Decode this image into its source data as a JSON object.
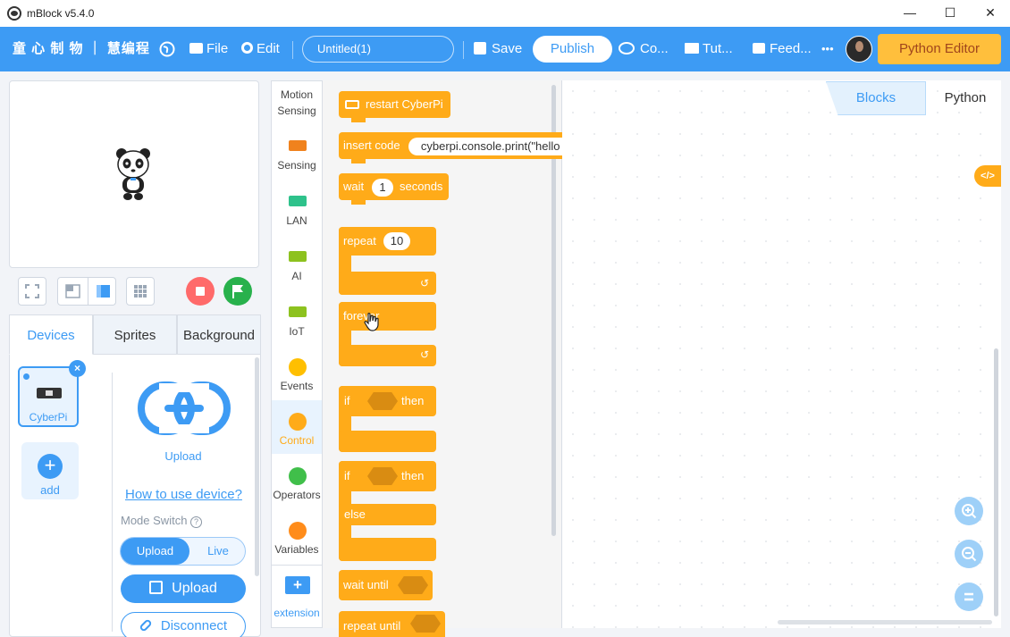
{
  "window": {
    "title": "mBlock v5.4.0",
    "minimize": "—",
    "maximize": "☐",
    "close": "✕"
  },
  "menu": {
    "brand_text": "童 心 制 物 ｜ 慧编程",
    "file": "File",
    "edit": "Edit",
    "project_name": "Untitled(1)",
    "save": "Save",
    "publish": "Publish",
    "community": "Co...",
    "tutorials": "Tut...",
    "feedback": "Feed...",
    "more": "•••",
    "python_editor": "Python Editor"
  },
  "stage": {
    "panda_icon": "panda-sprite"
  },
  "left_tabs": [
    "Devices",
    "Sprites",
    "Background"
  ],
  "device": {
    "name": "CyberPi",
    "add_label": "add",
    "upload_caption": "Upload",
    "help_link": "How to use device?",
    "mode_switch": "Mode Switch",
    "mode_upload": "Upload",
    "mode_live": "Live",
    "upload_button": "Upload",
    "disconnect_button": "Disconnect"
  },
  "categories": [
    {
      "label": "Motion Sensing"
    },
    {
      "label": "Sensing"
    },
    {
      "label": "LAN"
    },
    {
      "label": "AI"
    },
    {
      "label": "IoT"
    },
    {
      "label": "Events"
    },
    {
      "label": "Control"
    },
    {
      "label": "Operators"
    },
    {
      "label": "Variables"
    },
    {
      "label": "extension"
    }
  ],
  "blocks": {
    "restart": "restart CyberPi",
    "insert_code": "insert code",
    "insert_code_value": "cyberpi.console.print(\"hello world\")",
    "wait": "wait",
    "wait_value": "1",
    "seconds": "seconds",
    "repeat": "repeat",
    "repeat_value": "10",
    "forever": "forever",
    "if": "if",
    "then": "then",
    "if2": "if",
    "then2": "then",
    "else": "else",
    "wait_until": "wait until",
    "repeat_until": "repeat until"
  },
  "workspace_tabs": {
    "blocks": "Blocks",
    "python": "Python"
  },
  "colors": {
    "accent": "#3d9bf4",
    "block": "#ffab19",
    "python_editor_bg": "#ffbf3c"
  }
}
